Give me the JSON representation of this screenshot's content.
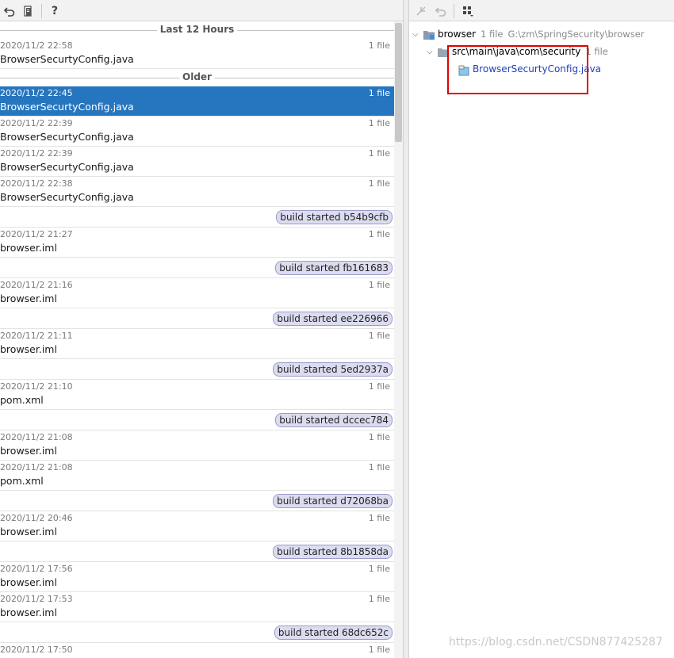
{
  "left_toolbar": {
    "icons": [
      "revert-icon",
      "file-diff-icon",
      "help-icon"
    ],
    "help_label": "?"
  },
  "groups": [
    {
      "title": "Last 12 Hours",
      "rows": [
        {
          "kind": "entry",
          "date": "2020/11/2 22:58",
          "count": "1 file",
          "file": "BrowserSecurtyConfig.java"
        }
      ]
    },
    {
      "title": "Older",
      "rows": [
        {
          "kind": "entry",
          "date": "2020/11/2 22:45",
          "count": "1 file",
          "file": "BrowserSecurtyConfig.java",
          "selected": true
        },
        {
          "kind": "entry",
          "date": "2020/11/2 22:39",
          "count": "1 file",
          "file": "BrowserSecurtyConfig.java"
        },
        {
          "kind": "entry",
          "date": "2020/11/2 22:39",
          "count": "1 file",
          "file": "BrowserSecurtyConfig.java"
        },
        {
          "kind": "entry",
          "date": "2020/11/2 22:38",
          "count": "1 file",
          "file": "BrowserSecurtyConfig.java"
        },
        {
          "kind": "label",
          "text": "build started b54b9cfb"
        },
        {
          "kind": "entry",
          "date": "2020/11/2 21:27",
          "count": "1 file",
          "file": "browser.iml"
        },
        {
          "kind": "label",
          "text": "build started fb161683"
        },
        {
          "kind": "entry",
          "date": "2020/11/2 21:16",
          "count": "1 file",
          "file": "browser.iml"
        },
        {
          "kind": "label",
          "text": "build started ee226966"
        },
        {
          "kind": "entry",
          "date": "2020/11/2 21:11",
          "count": "1 file",
          "file": "browser.iml"
        },
        {
          "kind": "label",
          "text": "build started 5ed2937a"
        },
        {
          "kind": "entry",
          "date": "2020/11/2 21:10",
          "count": "1 file",
          "file": "pom.xml"
        },
        {
          "kind": "label",
          "text": "build started dccec784"
        },
        {
          "kind": "entry",
          "date": "2020/11/2 21:08",
          "count": "1 file",
          "file": "browser.iml"
        },
        {
          "kind": "entry",
          "date": "2020/11/2 21:08",
          "count": "1 file",
          "file": "pom.xml"
        },
        {
          "kind": "label",
          "text": "build started d72068ba"
        },
        {
          "kind": "entry",
          "date": "2020/11/2 20:46",
          "count": "1 file",
          "file": "browser.iml"
        },
        {
          "kind": "label",
          "text": "build started 8b1858da"
        },
        {
          "kind": "entry",
          "date": "2020/11/2 17:56",
          "count": "1 file",
          "file": "browser.iml"
        },
        {
          "kind": "entry",
          "date": "2020/11/2 17:53",
          "count": "1 file",
          "file": "browser.iml"
        },
        {
          "kind": "label",
          "text": "build started 68dc652c"
        },
        {
          "kind": "entry",
          "date": "2020/11/2 17:50",
          "count": "1 file",
          "file": ""
        }
      ]
    }
  ],
  "right_toolbar": {
    "icons": [
      "merge-icon",
      "revert-icon",
      "group-by-icon"
    ]
  },
  "tree": {
    "root": {
      "name": "browser",
      "count": "1 file",
      "path": "G:\\zm\\SpringSecurity\\browser"
    },
    "folder": {
      "name": "src\\main\\java\\com\\security",
      "count": "1 file"
    },
    "file": {
      "name": "BrowserSecurtyConfig.java"
    }
  },
  "watermark": "https://blog.csdn.net/CSDN877425287",
  "colors": {
    "selection": "#2675bf",
    "badge_bg": "#dcdcf0",
    "highlight": "#e00000",
    "link": "#1f3fbd"
  }
}
